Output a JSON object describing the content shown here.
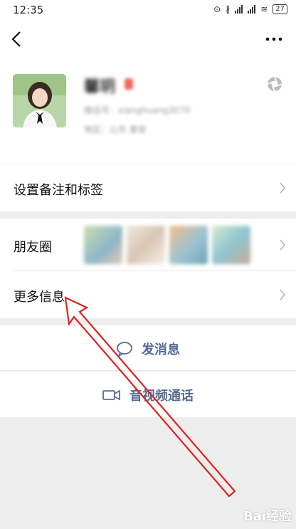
{
  "status_bar": {
    "time": "12:35",
    "battery": "27"
  },
  "profile": {
    "nickname": "馨玥",
    "wechat_id": "微信号：xianghuang3070",
    "region": "地区：山东  泰安"
  },
  "rows": {
    "remark_label": "设置备注和标签",
    "moments_label": "朋友圈",
    "more_info_label": "更多信息"
  },
  "actions": {
    "message_label": "发消息",
    "video_call_label": "音视频通话"
  },
  "watermark": "Bai经验",
  "colors": {
    "link_blue": "#576b95",
    "annotation_red": "#e02020"
  },
  "icons": [
    "back-arrow-icon",
    "more-dots-icon",
    "camera-icon",
    "chevron-right-icon",
    "chat-bubble-icon",
    "video-camera-icon"
  ]
}
